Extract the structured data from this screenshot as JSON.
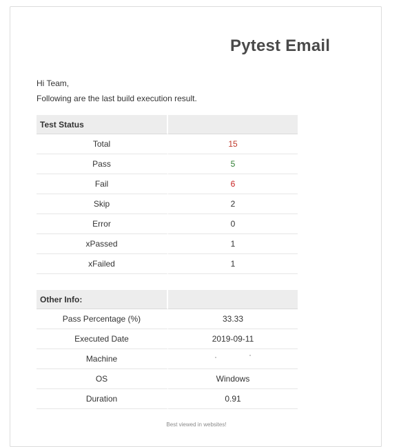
{
  "email": {
    "title": "Pytest Email",
    "greeting": "Hi Team,",
    "intro": "Following are the last build execution result.",
    "footer": "Best viewed in websites!"
  },
  "test_status": {
    "header": "Test Status",
    "rows": [
      {
        "label": "Total",
        "value": "15",
        "color": "#c0392b"
      },
      {
        "label": "Pass",
        "value": "5",
        "color": "#2e7d32"
      },
      {
        "label": "Fail",
        "value": "6",
        "color": "#c82020"
      },
      {
        "label": "Skip",
        "value": "2"
      },
      {
        "label": "Error",
        "value": "0"
      },
      {
        "label": "xPassed",
        "value": "1"
      },
      {
        "label": "xFailed",
        "value": "1"
      }
    ]
  },
  "other_info": {
    "header": "Other Info:",
    "rows": [
      {
        "label": "Pass Percentage (%)",
        "value": "33.33"
      },
      {
        "label": "Executed Date",
        "value": "2019-09-11"
      },
      {
        "label": "Machine",
        "value": ""
      },
      {
        "label": "OS",
        "value": "Windows"
      },
      {
        "label": "Duration",
        "value": "0.91"
      }
    ]
  }
}
